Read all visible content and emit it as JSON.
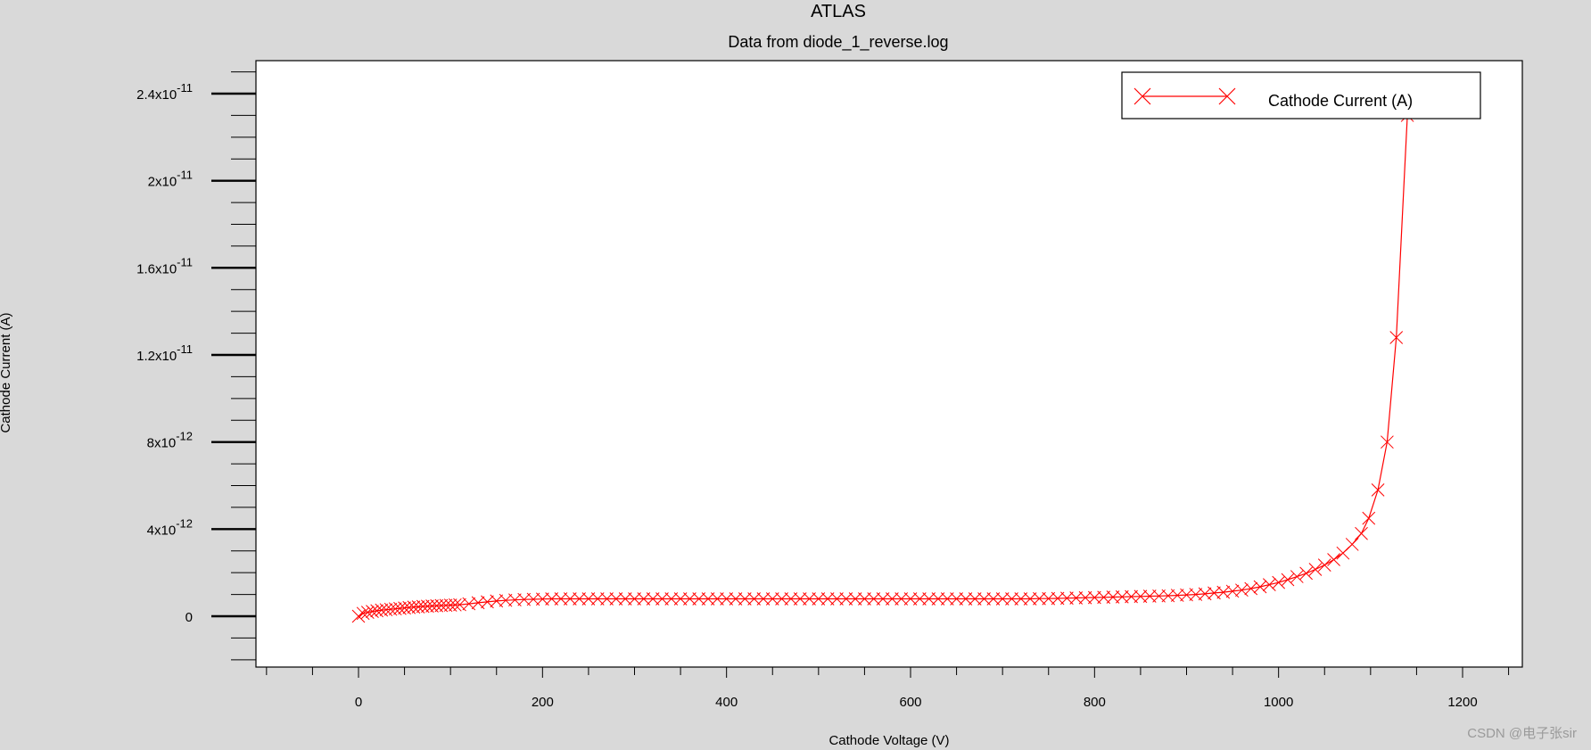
{
  "chart_data": {
    "type": "scatter",
    "title": "ATLAS",
    "subtitle": "Data from diode_1_reverse.log",
    "xlabel": "Cathode Voltage (V)",
    "ylabel": "Cathode Current (A)",
    "xlim": [
      -100,
      1250
    ],
    "ylim": [
      -2.8e-12,
      2.55e-11
    ],
    "grid": false,
    "legend_position": "top-right",
    "x_ticks": [
      0,
      200,
      400,
      600,
      800,
      1000,
      1200
    ],
    "x_tick_labels": [
      "0",
      "200",
      "400",
      "600",
      "800",
      "1000",
      "1200"
    ],
    "y_ticks": [
      {
        "value": 0,
        "mant": "0",
        "exp": ""
      },
      {
        "value": 4e-12,
        "mant": "4x10",
        "exp": "-12"
      },
      {
        "value": 8e-12,
        "mant": "8x10",
        "exp": "-12"
      },
      {
        "value": 1.2e-11,
        "mant": "1.2x10",
        "exp": "-11"
      },
      {
        "value": 1.6e-11,
        "mant": "1.6x10",
        "exp": "-11"
      },
      {
        "value": 2e-11,
        "mant": "2x10",
        "exp": "-11"
      },
      {
        "value": 2.4e-11,
        "mant": "2.4x10",
        "exp": "-11"
      }
    ],
    "series": [
      {
        "name": "Cathode Current (A)",
        "color": "#ff0000",
        "marker": "x",
        "x": [
          0,
          5,
          10,
          15,
          20,
          25,
          30,
          35,
          40,
          45,
          50,
          55,
          60,
          65,
          70,
          75,
          80,
          85,
          90,
          95,
          100,
          105,
          110,
          120,
          130,
          140,
          150,
          160,
          170,
          180,
          190,
          200,
          210,
          220,
          230,
          240,
          250,
          260,
          270,
          280,
          290,
          300,
          310,
          320,
          330,
          340,
          350,
          360,
          370,
          380,
          390,
          400,
          410,
          420,
          430,
          440,
          450,
          460,
          470,
          480,
          490,
          500,
          510,
          520,
          530,
          540,
          550,
          560,
          570,
          580,
          590,
          600,
          610,
          620,
          630,
          640,
          650,
          660,
          670,
          680,
          690,
          700,
          710,
          720,
          730,
          740,
          750,
          760,
          770,
          780,
          790,
          800,
          810,
          820,
          830,
          840,
          850,
          860,
          870,
          880,
          890,
          900,
          910,
          920,
          930,
          940,
          950,
          960,
          970,
          980,
          990,
          1000,
          1010,
          1020,
          1030,
          1040,
          1050,
          1060,
          1070,
          1080,
          1090,
          1098,
          1108,
          1118,
          1128,
          1140
        ],
        "y": [
          0.0,
          1.3e-13,
          1.8e-13,
          2.2e-13,
          2.5e-13,
          2.8e-13,
          3e-13,
          3.2e-13,
          3.4e-13,
          3.6e-13,
          3.8e-13,
          4e-13,
          4.2e-13,
          4.3e-13,
          4.5e-13,
          4.6e-13,
          4.7e-13,
          4.8e-13,
          4.9e-13,
          5e-13,
          5.1e-13,
          5.2e-13,
          5.3e-13,
          5.7e-13,
          6.2e-13,
          6.6e-13,
          7e-13,
          7.3e-13,
          7.5e-13,
          7.7e-13,
          7.8e-13,
          7.9e-13,
          8e-13,
          8e-13,
          8e-13,
          8e-13,
          8e-13,
          8e-13,
          8e-13,
          8e-13,
          8e-13,
          8e-13,
          8e-13,
          8e-13,
          8e-13,
          8e-13,
          8e-13,
          8e-13,
          8e-13,
          8e-13,
          8e-13,
          8e-13,
          8e-13,
          8e-13,
          8e-13,
          8e-13,
          8e-13,
          8e-13,
          8e-13,
          8e-13,
          8e-13,
          8e-13,
          8e-13,
          8e-13,
          8e-13,
          8e-13,
          8e-13,
          8e-13,
          8e-13,
          8e-13,
          8e-13,
          8e-13,
          8e-13,
          8e-13,
          8e-13,
          8e-13,
          8e-13,
          8e-13,
          8e-13,
          8e-13,
          8e-13,
          8e-13,
          8e-13,
          8e-13,
          8e-13,
          8.1e-13,
          8.1e-13,
          8.2e-13,
          8.3e-13,
          8.4e-13,
          8.5e-13,
          8.6e-13,
          8.7e-13,
          8.8e-13,
          8.9e-13,
          9e-13,
          9.1e-13,
          9.2e-13,
          9.3e-13,
          9.4e-13,
          9.6e-13,
          9.8e-13,
          1e-12,
          1.03e-12,
          1.07e-12,
          1.1e-12,
          1.15e-12,
          1.2e-12,
          1.27e-12,
          1.35e-12,
          1.45e-12,
          1.55e-12,
          1.68e-12,
          1.82e-12,
          1.97e-12,
          2.15e-12,
          2.35e-12,
          2.6e-12,
          2.9e-12,
          3.3e-12,
          3.8e-12,
          4.5e-12,
          5.8e-12,
          8e-12,
          1.28e-11,
          2.3e-11
        ]
      }
    ]
  },
  "watermark": "CSDN @电子张sir"
}
